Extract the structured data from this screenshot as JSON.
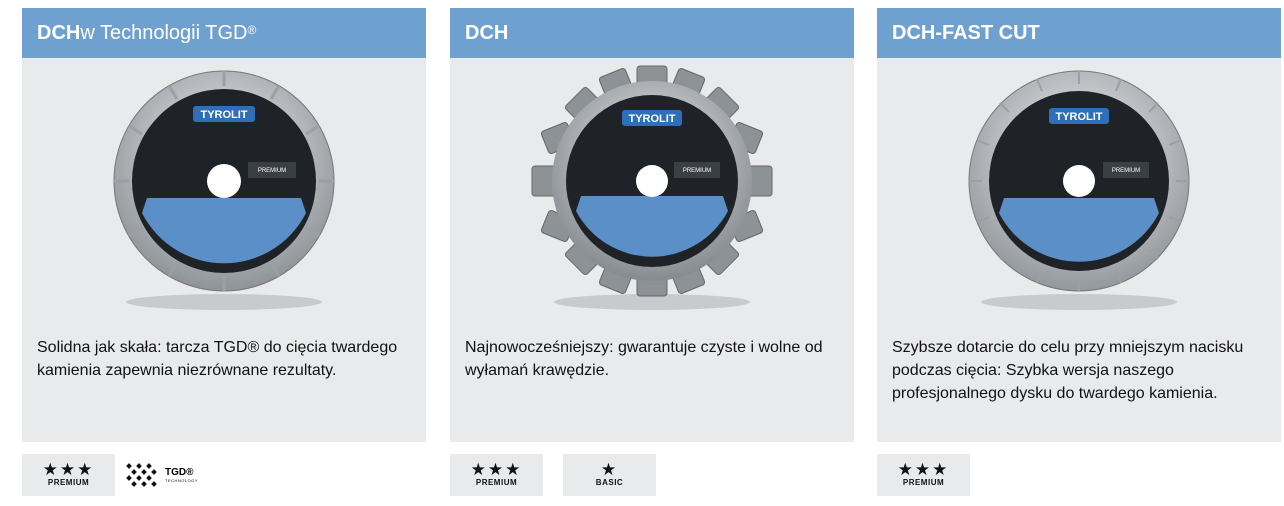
{
  "cards": [
    {
      "title_bold": "DCH",
      "title_rest": " w Technologii TGD",
      "title_reg": "®",
      "description": "Solidna jak skała: tarcza TGD® do cięcia twardego kamienia zapewnia niezrównane rezultaty.",
      "disc_brand": "TYROLIT",
      "disc_tier": "PREMIUM",
      "badges": [
        {
          "stars": "★★★",
          "label": "PREMIUM"
        }
      ],
      "tgd": {
        "label": "TGD®",
        "sub": "TECHNOLOGY"
      }
    },
    {
      "title_bold": "DCH",
      "description": "Najnowocześniejszy: gwarantuje czyste i wolne od wyłamań krawędzie.",
      "disc_brand": "TYROLIT",
      "disc_tier": "PREMIUM",
      "badges": [
        {
          "stars": "★★★",
          "label": "PREMIUM"
        },
        {
          "stars": "★",
          "label": "BASIC"
        }
      ]
    },
    {
      "title_bold": "DCH-FAST CUT",
      "description": "Szybsze dotarcie do celu przy mniejszym nacisku podczas cięcia: Szybka wersja naszego profesjonalnego dysku do twardego kamienia.",
      "disc_brand": "TYROLIT",
      "disc_tier": "PREMIUM",
      "badges": [
        {
          "stars": "★★★",
          "label": "PREMIUM"
        }
      ]
    }
  ],
  "colors": {
    "header_bg": "#6fa1d0",
    "card_bg": "#e9eaec",
    "disc_label_blue": "#5b8fc7"
  }
}
